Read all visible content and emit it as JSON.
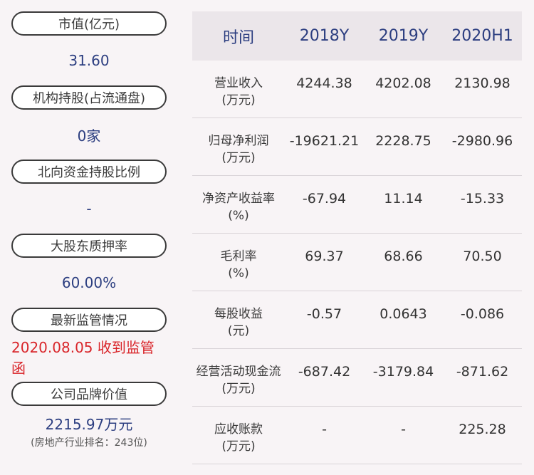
{
  "left": [
    {
      "label": "市值(亿元)",
      "value": "31.60"
    },
    {
      "label": "机构持股(占流通盘)",
      "value": "0家"
    },
    {
      "label": "北向资金持股比例",
      "value": "-"
    },
    {
      "label": "大股东质押率",
      "value": "60.00%"
    },
    {
      "label": "最新监管情况",
      "value": "2020.08.05 收到监管函"
    },
    {
      "label": "公司品牌价值",
      "value": "2215.97万元",
      "sub": "(房地产行业排名：243位)"
    }
  ],
  "table": {
    "headers": [
      "时间",
      "2018Y",
      "2019Y",
      "2020H1"
    ],
    "rows": [
      {
        "name": "营业收入",
        "unit": "(万元)",
        "values": [
          "4244.38",
          "4202.08",
          "2130.98"
        ]
      },
      {
        "name": "归母净利润",
        "unit": "(万元)",
        "values": [
          "-19621.21",
          "2228.75",
          "-2980.96"
        ]
      },
      {
        "name": "净资产收益率",
        "unit": "(%)",
        "values": [
          "-67.94",
          "11.14",
          "-15.33"
        ]
      },
      {
        "name": "毛利率",
        "unit": "(%)",
        "values": [
          "69.37",
          "68.66",
          "70.50"
        ]
      },
      {
        "name": "每股收益",
        "unit": "(元)",
        "values": [
          "-0.57",
          "0.0643",
          "-0.086"
        ]
      },
      {
        "name": "经营活动现金流",
        "unit": "(万元)",
        "values": [
          "-687.42",
          "-3179.84",
          "-871.62"
        ]
      },
      {
        "name": "应收账款",
        "unit": "(万元)",
        "values": [
          "-",
          "-",
          "225.28"
        ]
      }
    ]
  },
  "colors": {
    "value": "#2c3e80",
    "alert": "#d9252a",
    "header_bg": "#ebe6ea",
    "page_bg": "#f8f4f6"
  }
}
